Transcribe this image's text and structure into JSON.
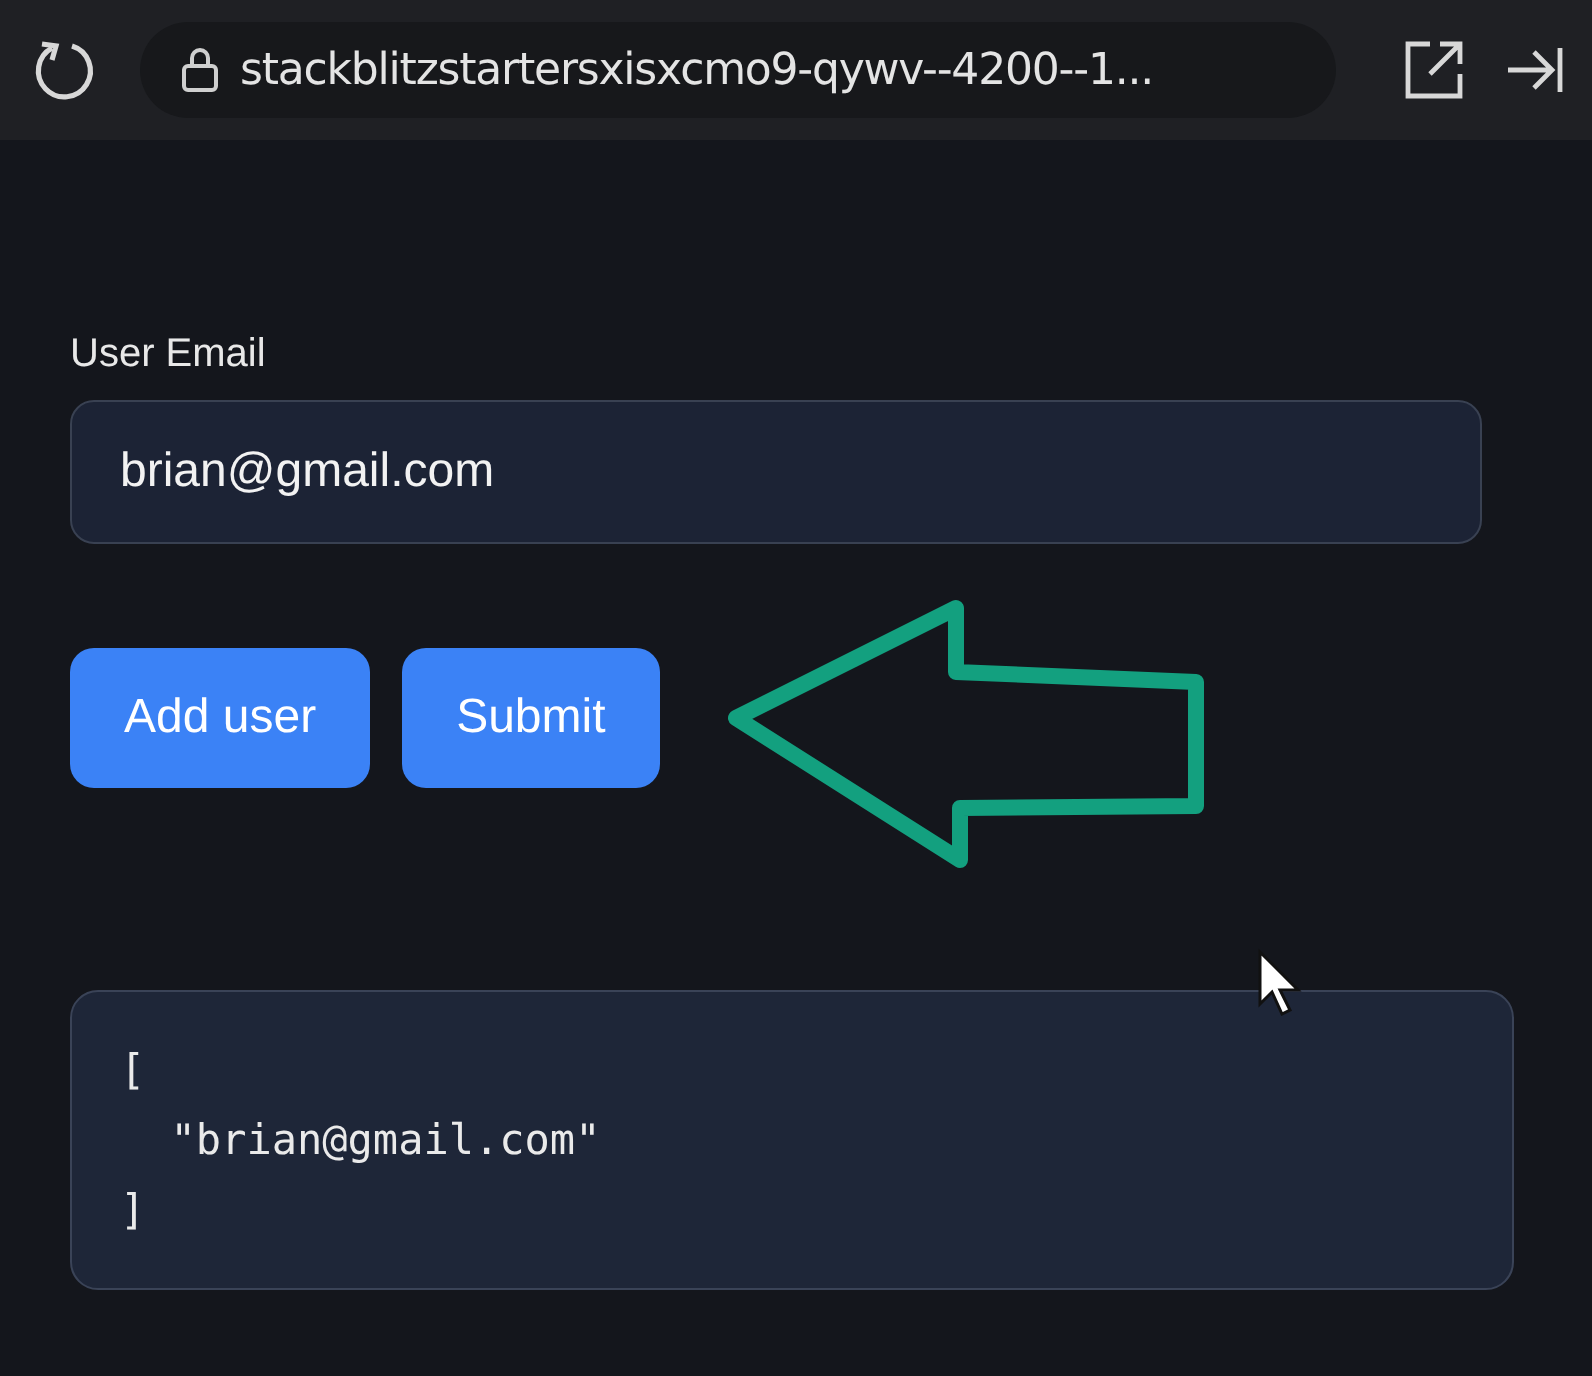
{
  "browser_bar": {
    "address": "stackblitzstartersxisxcmo9-qywv--4200--1..."
  },
  "form": {
    "label": "User Email",
    "email_value": "brian@gmail.com"
  },
  "buttons": [
    "Add user",
    "Submit"
  ],
  "output": "[\n  \"brian@gmail.com\"\n]"
}
